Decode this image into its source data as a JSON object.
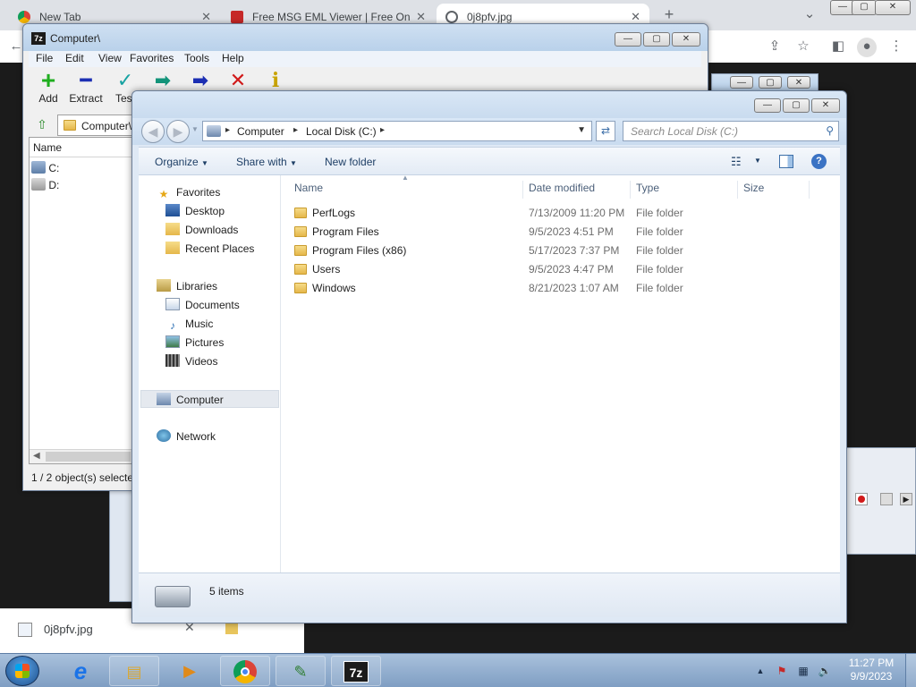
{
  "browser": {
    "tabs": [
      {
        "title": "New Tab",
        "active": false
      },
      {
        "title": "Free MSG EML Viewer | Free Onli",
        "active": false
      },
      {
        "title": "0j8pfv.jpg",
        "active": true
      }
    ],
    "new_tab_symbol": "+",
    "chevron_symbol": "⌄",
    "window_min": "—",
    "window_max": "▢",
    "window_close": "✕"
  },
  "download": {
    "filename": "0j8pfv.jpg",
    "close_symbol": "✕"
  },
  "sevenzip": {
    "title": "Computer\\",
    "app_icon_text": "7z",
    "menu": [
      "File",
      "Edit",
      "View",
      "Favorites",
      "Tools",
      "Help"
    ],
    "toolbar": [
      {
        "label": "Add",
        "icon": "plus-icon",
        "glyph": "+",
        "color": "#1fae1f"
      },
      {
        "label": "Extract",
        "icon": "minus-icon",
        "glyph": "━",
        "color": "#1c2fb3"
      },
      {
        "label": "Test",
        "icon": "check-icon",
        "glyph": "✓",
        "color": "#16a2a2"
      },
      {
        "label": "",
        "icon": "copy-arrow-icon",
        "glyph": "➡",
        "color": "#13947a"
      },
      {
        "label": "",
        "icon": "move-arrow-icon",
        "glyph": "➡",
        "color": "#1c2fb3"
      },
      {
        "label": "",
        "icon": "delete-icon",
        "glyph": "✕",
        "color": "#d11a1a"
      },
      {
        "label": "",
        "icon": "info-icon",
        "glyph": "i",
        "color": "#c9a400"
      }
    ],
    "address": "Computer\\",
    "list_header": "Name",
    "drives": [
      {
        "name": "C:",
        "icon": "drive-icon"
      },
      {
        "name": "D:",
        "icon": "disc-drive-icon"
      }
    ],
    "status": "1 / 2 object(s) selecte"
  },
  "explorer": {
    "breadcrumb": [
      "Computer",
      "Local Disk (C:)"
    ],
    "search_placeholder": "Search Local Disk (C:)",
    "commands": {
      "organize": "Organize",
      "share_with": "Share with",
      "new_folder": "New folder"
    },
    "nav": {
      "favorites": "Favorites",
      "desktop": "Desktop",
      "downloads": "Downloads",
      "recent": "Recent Places",
      "libraries": "Libraries",
      "documents": "Documents",
      "music": "Music",
      "pictures": "Pictures",
      "videos": "Videos",
      "computer": "Computer",
      "network": "Network"
    },
    "columns": {
      "name": "Name",
      "date": "Date modified",
      "type": "Type",
      "size": "Size"
    },
    "files": [
      {
        "name": "PerfLogs",
        "date": "7/13/2009 11:20 PM",
        "type": "File folder",
        "size": ""
      },
      {
        "name": "Program Files",
        "date": "9/5/2023 4:51 PM",
        "type": "File folder",
        "size": ""
      },
      {
        "name": "Program Files (x86)",
        "date": "5/17/2023 7:37 PM",
        "type": "File folder",
        "size": ""
      },
      {
        "name": "Users",
        "date": "9/5/2023 4:47 PM",
        "type": "File folder",
        "size": ""
      },
      {
        "name": "Windows",
        "date": "8/21/2023 1:07 AM",
        "type": "File folder",
        "size": ""
      }
    ],
    "item_count": "5 items"
  },
  "taskbar": {
    "items": [
      {
        "name": "ie-icon",
        "glyph": "e"
      },
      {
        "name": "explorer-taskbar-icon",
        "glyph": "▤"
      },
      {
        "name": "media-player-icon",
        "glyph": "▶"
      },
      {
        "name": "chrome-icon",
        "glyph": "●"
      },
      {
        "name": "notepadpp-icon",
        "glyph": "✎"
      },
      {
        "name": "sevenzip-taskbar-icon",
        "glyph": "7z"
      }
    ],
    "time": "11:27 PM",
    "date": "9/9/2023"
  },
  "colors": {
    "accent": "#1a73e8",
    "chrome_tab_bg": "#dee1e6",
    "taskbar": "#8fadd0"
  }
}
